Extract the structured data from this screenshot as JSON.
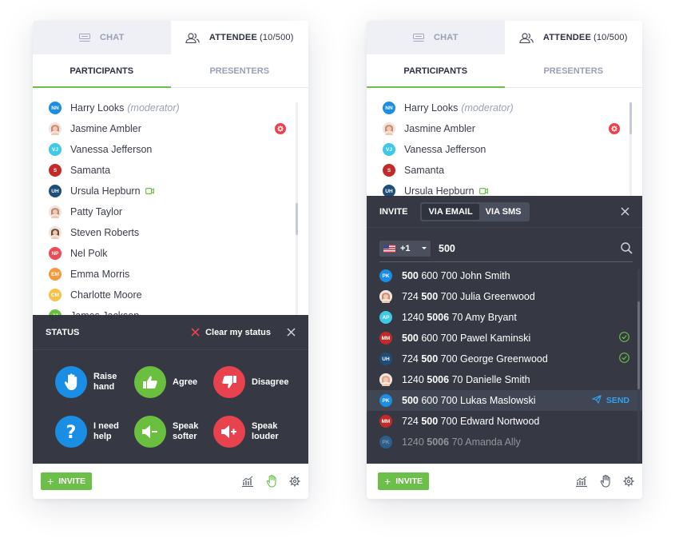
{
  "panel_left": {
    "tabs": [
      {
        "label": "CHAT",
        "active": false
      },
      {
        "label": "ATTENDEE",
        "count": "(10/500)",
        "active": true
      }
    ],
    "subtabs": [
      {
        "label": "PARTICIPANTS",
        "active": true
      },
      {
        "label": "PRESENTERS",
        "active": false
      }
    ],
    "participants": [
      {
        "name": "Harry Looks",
        "tag": "(moderator)",
        "initials": "NN",
        "color": "#1a8de4"
      },
      {
        "name": "Jasmine Ambler",
        "initials": "",
        "color": "#c98a7a",
        "photo": true,
        "badge": "gear-icon"
      },
      {
        "name": "Vanessa Jefferson",
        "initials": "VJ",
        "color": "#3fc9e8"
      },
      {
        "name": "Samanta",
        "initials": "S",
        "color": "#c42a2a"
      },
      {
        "name": "Ursula Hepburn",
        "initials": "UH",
        "color": "#1d4e7a",
        "camera": true
      },
      {
        "name": "Patty Taylor",
        "initials": "",
        "color": "#b58a76",
        "photo": true
      },
      {
        "name": "Steven Roberts",
        "initials": "",
        "color": "#6b4a3a",
        "photo": true
      },
      {
        "name": "Nel Polk",
        "initials": "NP",
        "color": "#ef4b55"
      },
      {
        "name": "Emma Morris",
        "initials": "EM",
        "color": "#f39a3c"
      },
      {
        "name": "Charlotte Moore",
        "initials": "CM",
        "color": "#f7c14a"
      },
      {
        "name": "James Jackson",
        "initials": "JJ",
        "color": "#6bbf3f"
      }
    ],
    "status_panel": {
      "title": "STATUS",
      "clear_label": "Clear my status",
      "items": [
        {
          "label": "Raise hand",
          "icon": "raise-hand-icon",
          "color": "blue"
        },
        {
          "label": "Agree",
          "icon": "thumbs-up-icon",
          "color": "green"
        },
        {
          "label": "Disagree",
          "icon": "thumbs-down-icon",
          "color": "red"
        },
        {
          "label": "I need help",
          "icon": "question-icon",
          "color": "blue"
        },
        {
          "label": "Speak softer",
          "icon": "volume-down-icon",
          "color": "green"
        },
        {
          "label": "Speak louder",
          "icon": "volume-up-icon",
          "color": "red"
        }
      ]
    },
    "footer": {
      "invite_label": "INVITE"
    }
  },
  "panel_right": {
    "tabs": [
      {
        "label": "CHAT",
        "active": false
      },
      {
        "label": "ATTENDEE",
        "count": "(10/500)",
        "active": true
      }
    ],
    "subtabs": [
      {
        "label": "PARTICIPANTS",
        "active": true
      },
      {
        "label": "PRESENTERS",
        "active": false
      }
    ],
    "participants": [
      {
        "name": "Harry Looks",
        "tag": "(moderator)",
        "initials": "NN",
        "color": "#1a8de4"
      },
      {
        "name": "Jasmine Ambler",
        "initials": "",
        "color": "#c98a7a",
        "photo": true,
        "badge": "gear-icon"
      },
      {
        "name": "Vanessa Jefferson",
        "initials": "VJ",
        "color": "#3fc9e8"
      },
      {
        "name": "Samanta",
        "initials": "S",
        "color": "#c42a2a"
      },
      {
        "name": "Ursula Hepburn",
        "initials": "UH",
        "color": "#1d4e7a",
        "camera": true
      }
    ],
    "invite_panel": {
      "title": "INVITE",
      "tabs": [
        {
          "label": "VIA EMAIL",
          "active": true
        },
        {
          "label": "VIA SMS",
          "active": false
        }
      ],
      "country_code": "+1",
      "search_value": "500",
      "results": [
        {
          "pre": "",
          "match": "500",
          "post": " 600 700 John Smith",
          "initials": "PK",
          "color": "#1a8de4"
        },
        {
          "pre": "724 ",
          "match": "500",
          "post": " 700 Julia Greenwood",
          "initials": "",
          "color": "#c98a7a",
          "photo": true
        },
        {
          "pre": "1240 ",
          "match": "5006",
          "post": " 70 Amy Bryant",
          "initials": "AP",
          "color": "#3fc9e8"
        },
        {
          "pre": "",
          "match": "500",
          "post": " 600 700 Pawel Kaminski",
          "initials": "MM",
          "color": "#c42a2a",
          "invited": true
        },
        {
          "pre": "724 ",
          "match": "500",
          "post": " 700 George Greenwood",
          "initials": "UH",
          "color": "#1d4e7a",
          "invited": true
        },
        {
          "pre": "1240 ",
          "match": "5006",
          "post": " 70 Danielle Smith",
          "initials": "",
          "color": "#d8a58a",
          "photo": true
        },
        {
          "pre": "",
          "match": "500",
          "post": " 600 700 Lukas Maslowski",
          "initials": "PK",
          "color": "#1a8de4",
          "highlight": true,
          "action": "SEND"
        },
        {
          "pre": "724 ",
          "match": "500",
          "post": " 700 Edward Nortwood",
          "initials": "MM",
          "color": "#c42a2a"
        },
        {
          "pre": "1240 ",
          "match": "5006",
          "post": " 70 Amanda Ally",
          "initials": "PK",
          "color": "#1a8de4",
          "faded": true
        }
      ]
    },
    "footer": {
      "invite_label": "INVITE"
    }
  },
  "colors": {
    "accent_green": "#6cc04a",
    "dark_panel": "#2f333e",
    "send_blue": "#31a2f2",
    "alert_red": "#e9434f"
  }
}
